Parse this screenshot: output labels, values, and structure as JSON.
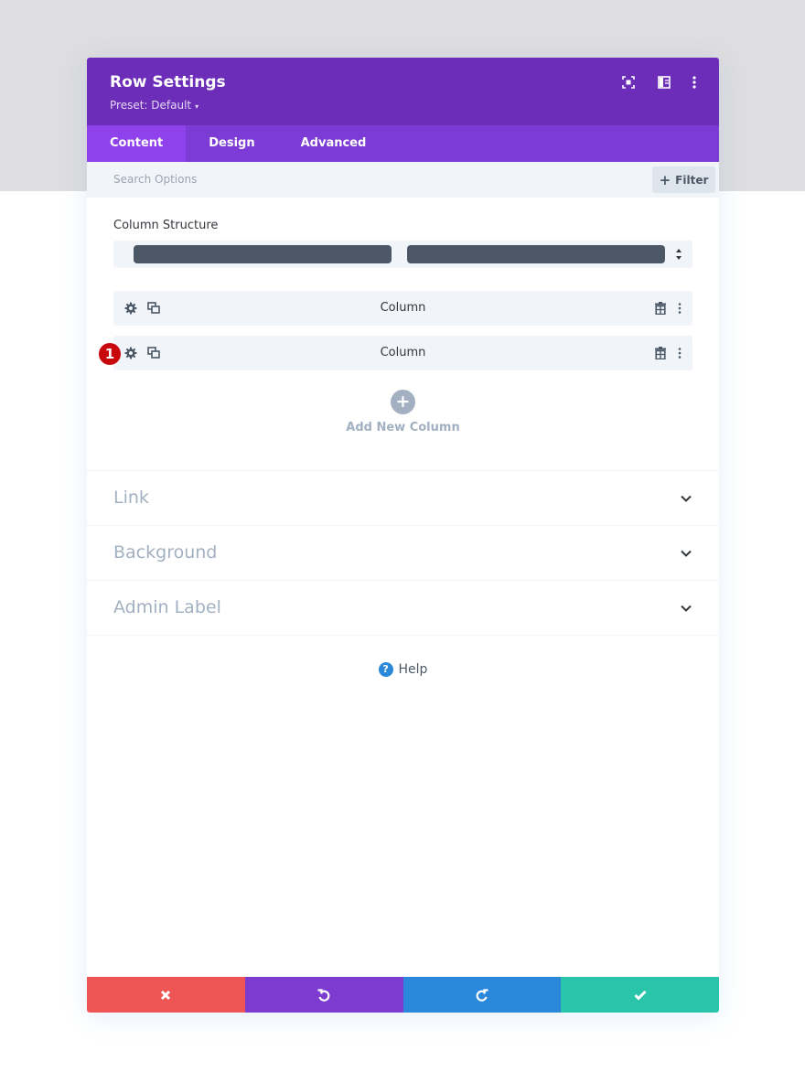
{
  "modal": {
    "title": "Row Settings",
    "preset_label": "Preset: Default",
    "preset_caret": "▾"
  },
  "header_icons": [
    "fullscreen-icon",
    "sidebar-layout-icon",
    "more-options-icon"
  ],
  "tabs": [
    {
      "label": "Content",
      "active": true
    },
    {
      "label": "Design",
      "active": false
    },
    {
      "label": "Advanced",
      "active": false
    }
  ],
  "search": {
    "placeholder": "Search Options",
    "filter_label": "Filter",
    "filter_icon": "+"
  },
  "column_structure": {
    "label": "Column Structure",
    "selected_columns": 2
  },
  "columns": [
    {
      "label": "Column",
      "badge": ""
    },
    {
      "label": "Column",
      "badge": "1"
    }
  ],
  "add_column": {
    "icon": "+",
    "label": "Add New Column"
  },
  "toggles": [
    {
      "label": "Link"
    },
    {
      "label": "Background"
    },
    {
      "label": "Admin Label"
    }
  ],
  "help": {
    "icon": "?",
    "label": "Help"
  },
  "footer": {
    "buttons": [
      {
        "name": "discard",
        "color": "#ef5555"
      },
      {
        "name": "undo",
        "color": "#7e3bd0"
      },
      {
        "name": "redo",
        "color": "#2b87da"
      },
      {
        "name": "save",
        "color": "#29c4a9"
      }
    ]
  },
  "colors": {
    "header": "#6c2eb9",
    "tabs": "#7d3bd6",
    "active_tab": "#8f42ec",
    "badge": "#c9080d"
  }
}
